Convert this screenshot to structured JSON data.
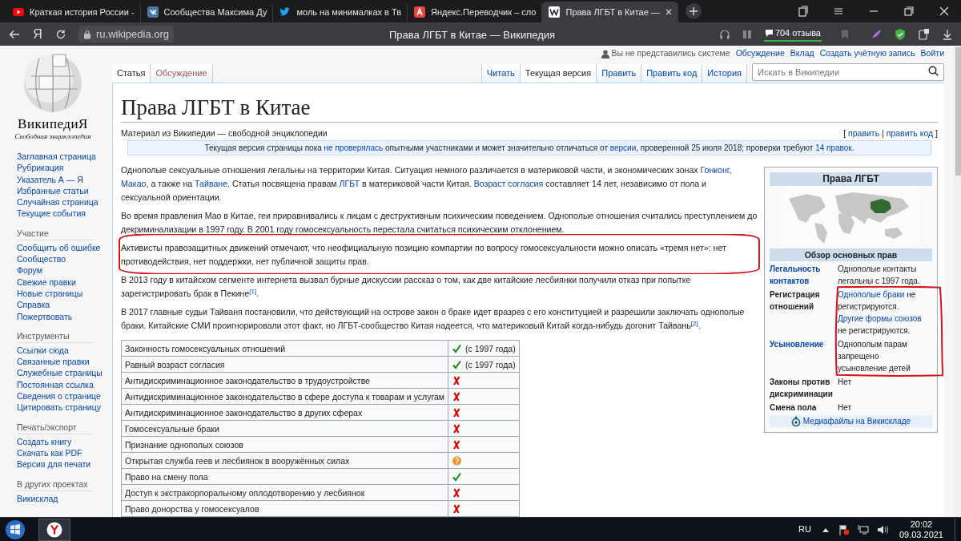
{
  "browser": {
    "tabs": [
      {
        "kind": "video",
        "title": "Краткая история России -",
        "selected": false
      },
      {
        "kind": "vk",
        "title": "Сообщества Максима Ду",
        "selected": false
      },
      {
        "kind": "bird",
        "title": "моль на минималках в Тв",
        "selected": false
      },
      {
        "kind": "translate",
        "title": "Яндекс.Переводчик – сло",
        "selected": false
      },
      {
        "kind": "wiki",
        "title": "Права ЛГБТ в Китае —",
        "selected": true
      }
    ],
    "logo": "Я",
    "url": "ru.wikipedia.org",
    "page_title": "Права ЛГБТ в Китае — Википедия",
    "reviews": "704 отзыва"
  },
  "personal": {
    "status": "Вы не представились системе",
    "links": [
      "Обсуждение",
      "Вклад",
      "Создать учётную запись",
      "Войти"
    ]
  },
  "logo": {
    "name": "ВикипедиЯ",
    "tagline": "Свободная энциклопедия"
  },
  "sidebar": [
    {
      "items": [
        "Заглавная страница",
        "Рубрикация",
        "Указатель А — Я",
        "Избранные статьи",
        "Случайная страница",
        "Текущие события"
      ]
    },
    {
      "heading": "Участие",
      "items": [
        "Сообщить об ошибке",
        "Сообщество",
        "Форум",
        "Свежие правки",
        "Новые страницы",
        "Справка",
        "Пожертвовать"
      ]
    },
    {
      "heading": "Инструменты",
      "items": [
        "Ссылки сюда",
        "Связанные правки",
        "Служебные страницы",
        "Постоянная ссылка",
        "Сведения о странице",
        "Цитировать страницу"
      ]
    },
    {
      "heading": "Печать/экспорт",
      "items": [
        "Создать книгу",
        "Скачать как PDF",
        "Версия для печати"
      ]
    },
    {
      "heading": "В других проектах",
      "items": [
        "Викисклад"
      ]
    }
  ],
  "tabs_left": [
    {
      "label": "Статья",
      "selected": true,
      "missing": false
    },
    {
      "label": "Обсуждение",
      "selected": false,
      "missing": true
    }
  ],
  "tabs_right": [
    {
      "label": "Читать",
      "selected": false
    },
    {
      "label": "Текущая версия",
      "selected": true
    },
    {
      "label": "Править",
      "selected": false
    },
    {
      "label": "Править код",
      "selected": false
    },
    {
      "label": "История",
      "selected": false
    }
  ],
  "search": {
    "placeholder": "Искать в Википедии"
  },
  "article": {
    "title": "Права ЛГБТ в Китае",
    "subtitle": "Материал из Википедии — свободной энциклопедии",
    "edit_links": [
      {
        "text": "[ "
      },
      {
        "text": "править",
        "link": true
      },
      {
        "text": " | "
      },
      {
        "text": "править код",
        "link": true
      },
      {
        "text": " ]"
      }
    ],
    "notice": [
      {
        "text": "Текущая версия страницы пока "
      },
      {
        "text": "не проверялась",
        "link": true
      },
      {
        "text": " опытными участниками и может значительно отличаться от "
      },
      {
        "text": "версии",
        "link": true
      },
      {
        "text": ", проверенной 25 июля 2018; проверки требуют "
      },
      {
        "text": "14 правок",
        "link": true
      },
      {
        "text": "."
      }
    ],
    "paragraphs": [
      [
        {
          "text": "Однополые сексуальные отношения легальны на территории Китая. Ситуация немного различается в материковой части, и экономических зонах "
        },
        {
          "text": "Гонконг",
          "link": true
        },
        {
          "text": ", "
        },
        {
          "text": "Макао",
          "link": true
        },
        {
          "text": ", а также на "
        },
        {
          "text": "Тайване",
          "link": true
        },
        {
          "text": ". Статья посвящена правам "
        },
        {
          "text": "ЛГБТ",
          "link": true
        },
        {
          "text": " в материковой части Китая. "
        },
        {
          "text": "Возраст согласия",
          "link": true
        },
        {
          "text": " составляет 14 лет, независимо от пола и сексуальной ориентации."
        }
      ],
      [
        {
          "text": "Во время правления Мао в Китае, геи приравнивались к лицам с деструктивным психическим поведением. Однополые отношения считались преступлением до декриминализации в 1997 году. В 2001 году гомосексуальность перестала считаться психическим отклонением."
        }
      ],
      [
        {
          "text": "Активисты правозащитных движений отмечают, что неофициальную позицию компартии по вопросу гомосексуальности можно описать «тремя нет»: нет противодействия, нет поддержки, нет публичной защиты прав."
        }
      ],
      [
        {
          "text": "В 2013 году в китайском сегменте интернета вызвал бурные дискуссии рассказ о том, как две китайские лесбиянки получили отказ при попытке зарегистрировать брак в Пекине"
        },
        {
          "text": "[1]",
          "ref": true
        },
        {
          "text": "."
        }
      ],
      [
        {
          "text": "В 2017 главные судьи Тайваня постановили, что действующий на острове закон о браке идет вразрез с его конституцией и разрешили заключать однополые браки. Китайские СМИ проигнорировали этот факт, но ЛГБТ-сообщество Китая надеется, что материковый Китай когда-нибудь догонит Тайвань"
        },
        {
          "text": "[2]",
          "ref": true
        },
        {
          "text": "."
        }
      ]
    ],
    "rights_table": [
      {
        "label": "Законность гомосексуальных отношений",
        "kind": "yes",
        "note": "(с 1997 года)"
      },
      {
        "label": "Равный возраст согласия",
        "kind": "yes",
        "note": "(с 1997 года)"
      },
      {
        "label": "Антидискриминационное законодательство в трудоустройстве",
        "kind": "no"
      },
      {
        "label": "Антидискриминационное законодательство в сфере доступа к товарам и услугам",
        "kind": "no"
      },
      {
        "label": "Антидискриминационное законодательство в других сферах",
        "kind": "no"
      },
      {
        "label": "Гомосексуальные браки",
        "kind": "no"
      },
      {
        "label": "Признание однополых союзов",
        "kind": "no"
      },
      {
        "label": "Открытая служба геев и лесбиянок в вооружённых силах",
        "kind": "unknown"
      },
      {
        "label": "Право на смену пола",
        "kind": "yes"
      },
      {
        "label": "Доступ к экстракорпоральному оплодотворению у лесбиянок",
        "kind": "no"
      },
      {
        "label": "Право донорства у гомосексуалов",
        "kind": "no"
      }
    ]
  },
  "infobox": {
    "title": "Права ЛГБТ",
    "section": "Обзор основных прав",
    "rows": [
      {
        "label": "Легальность контактов",
        "label_link": true,
        "value": [
          {
            "text": "Однополые контакты легальны с 1997 года."
          }
        ]
      },
      {
        "label": "Регистрация отношений",
        "label_link": false,
        "value": [
          {
            "text": "Однополые браки",
            "link": true
          },
          {
            "text": " не регистрируются. "
          },
          {
            "text": "Другие формы союзов",
            "link": true
          },
          {
            "text": " не регистрируются."
          }
        ]
      },
      {
        "label": "Усыновление",
        "label_link": true,
        "value": [
          {
            "text": "Однополым парам запрещено усыновление детей"
          }
        ]
      },
      {
        "label": "Законы против дискриминации",
        "label_link": false,
        "value": [
          {
            "text": "Нет"
          }
        ]
      },
      {
        "label": "Смена пола",
        "label_link": false,
        "value": [
          {
            "text": "Нет"
          }
        ]
      }
    ],
    "commons": "Медиафайлы на Викискладе"
  },
  "taskbar": {
    "language": "RU",
    "time": "20:02",
    "date": "09.03.2021"
  }
}
